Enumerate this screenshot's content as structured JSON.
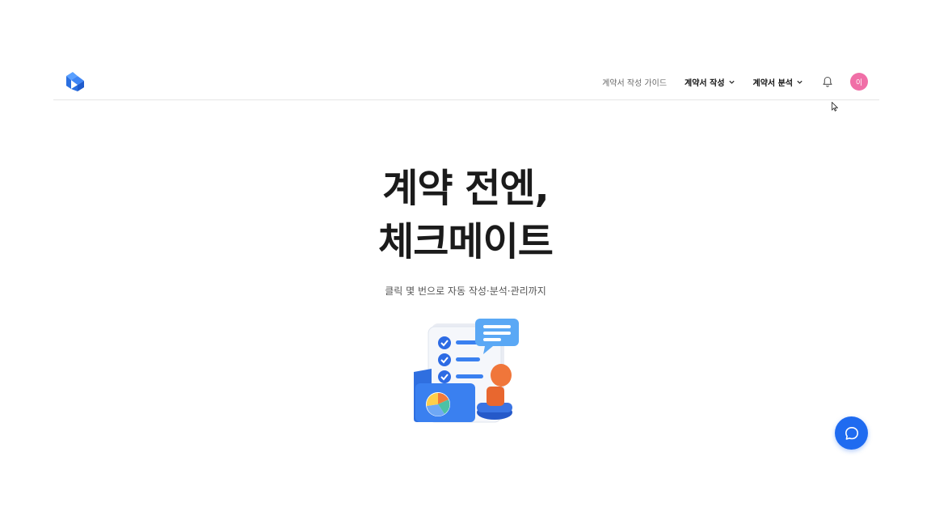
{
  "header": {
    "logo_label": "logo",
    "nav": {
      "guide_label": "계약서 작성 가이드",
      "write_label": "계약서 작성",
      "analyze_label": "계약서 분석"
    },
    "avatar_initial": "이"
  },
  "hero": {
    "title_line1": "계약 전엔,",
    "title_line2": "체크메이트",
    "subtitle": "클릭 몇 번으로 자동 작성·분석·관리까지"
  },
  "colors": {
    "brand_blue": "#1f6bf0",
    "avatar_pink": "#f06fa7"
  },
  "icons": [
    "bell-icon",
    "chevron-down-icon",
    "chat-icon",
    "cursor-icon"
  ]
}
